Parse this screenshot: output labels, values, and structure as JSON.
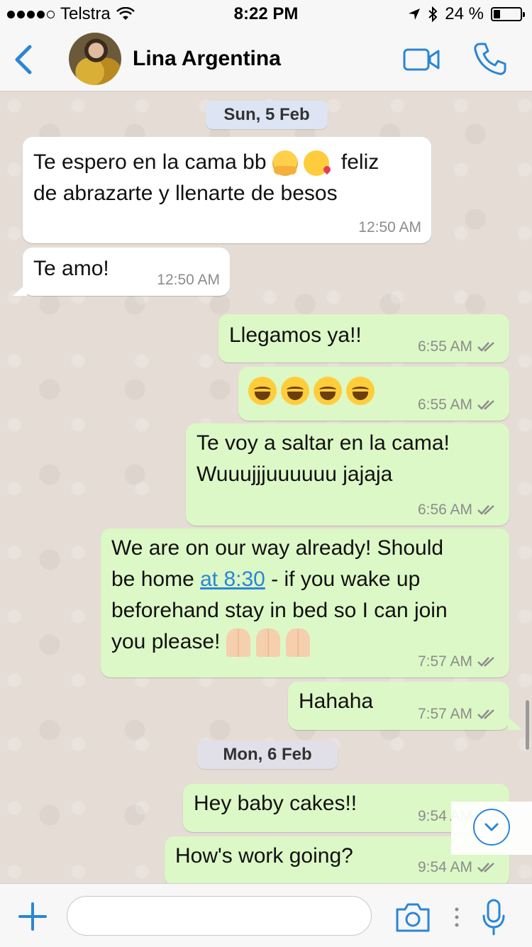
{
  "status_bar": {
    "carrier": "Telstra",
    "time": "8:22 PM",
    "battery_percent": "24 %",
    "battery_level": 0.24
  },
  "header": {
    "back_icon": "chevron-left-icon",
    "contact_name": "Lina Argentina",
    "video_icon": "video-camera-icon",
    "call_icon": "phone-icon",
    "accent_color": "#2a86d6"
  },
  "chat": {
    "date_separators": [
      "Sun, 5 Feb",
      "Mon, 6 Feb"
    ],
    "messages": [
      {
        "direction": "in",
        "lines": [
          "Te espero en la cama bb",
          "feliz",
          "de abrazarte y llenarte de besos"
        ],
        "emojis": [
          "hugging-face",
          "face-blowing-kiss"
        ],
        "time": "12:50 AM"
      },
      {
        "direction": "in",
        "text": "Te amo!",
        "time": "12:50 AM"
      },
      {
        "direction": "out",
        "text": "Llegamos ya!!",
        "time": "6:55 AM",
        "status": "read-double-tick"
      },
      {
        "direction": "out",
        "emojis": [
          "laughing-face",
          "laughing-face",
          "laughing-face",
          "laughing-face"
        ],
        "time": "6:55 AM",
        "status": "read-double-tick"
      },
      {
        "direction": "out",
        "lines": [
          "Te voy a saltar en la cama!",
          "Wuuujjjuuuuuu jajaja"
        ],
        "time": "6:56 AM",
        "status": "read-double-tick"
      },
      {
        "direction": "out",
        "lines": [
          "We are on our way already! Should",
          "be home",
          "at 8:30",
          "- if you wake up",
          "beforehand stay in bed so I can join",
          "you please!"
        ],
        "emojis": [
          "folded-hands",
          "folded-hands",
          "folded-hands"
        ],
        "time": "7:57 AM",
        "status": "read-double-tick"
      },
      {
        "direction": "out",
        "text": "Hahaha",
        "time": "7:57 AM",
        "status": "read-double-tick"
      },
      {
        "direction": "out",
        "text": "Hey baby cakes!!",
        "time": "9:54 AM",
        "status": "read-double-tick"
      },
      {
        "direction": "out",
        "text": "How's work going?",
        "time": "9:54 AM",
        "status": "read-double-tick"
      }
    ],
    "incoming_color": "#ffffff",
    "outgoing_color": "#dcf8c6"
  },
  "input_bar": {
    "placeholder": "",
    "plus_icon": "plus-icon",
    "camera_icon": "camera-icon",
    "mic_icon": "microphone-icon"
  }
}
